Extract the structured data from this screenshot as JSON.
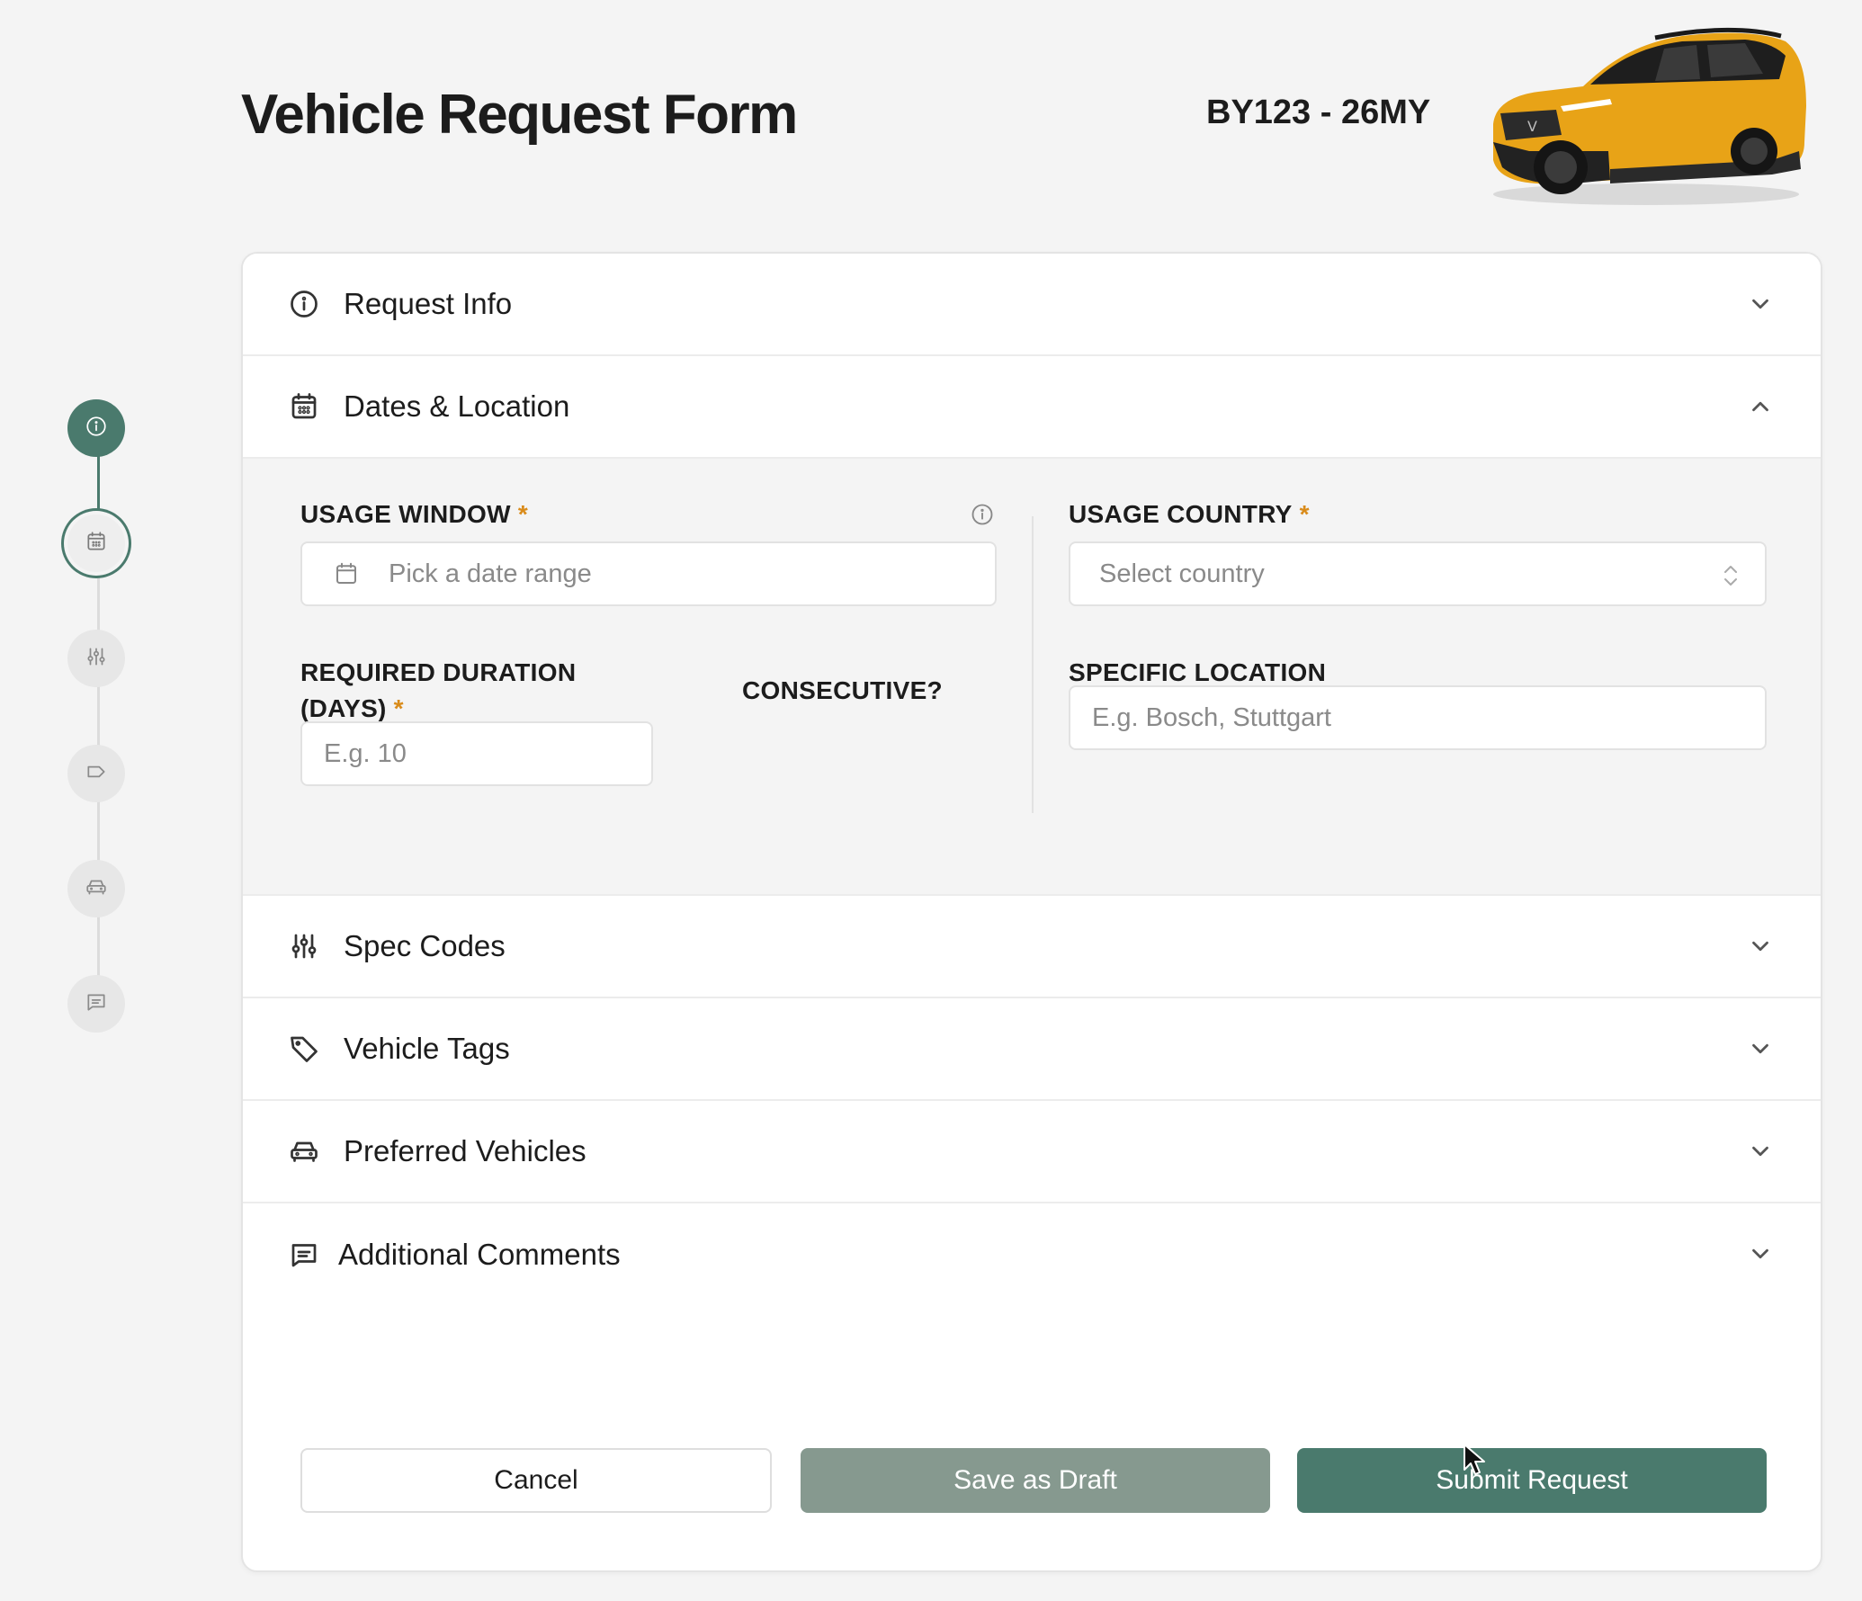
{
  "header": {
    "title": "Vehicle Request Form",
    "model_code": "BY123 - 26MY"
  },
  "stepper": {
    "steps": [
      {
        "icon": "info-icon",
        "state": "done"
      },
      {
        "icon": "calendar-icon",
        "state": "current"
      },
      {
        "icon": "sliders-icon",
        "state": "pending"
      },
      {
        "icon": "tag-icon",
        "state": "pending"
      },
      {
        "icon": "car-icon",
        "state": "pending"
      },
      {
        "icon": "comment-icon",
        "state": "pending"
      }
    ]
  },
  "sections": [
    {
      "title": "Request Info",
      "icon": "info-icon",
      "expanded": false
    },
    {
      "title": "Dates & Location",
      "icon": "calendar-icon",
      "expanded": true
    },
    {
      "title": "Spec Codes",
      "icon": "sliders-icon",
      "expanded": false
    },
    {
      "title": "Vehicle Tags",
      "icon": "tag-icon",
      "expanded": false
    },
    {
      "title": "Preferred Vehicles",
      "icon": "car-icon",
      "expanded": false
    },
    {
      "title": "Additional Comments",
      "icon": "comment-icon",
      "expanded": false
    }
  ],
  "dates_location": {
    "usage_window": {
      "label": "USAGE WINDOW",
      "required": "*",
      "placeholder": "Pick a date range"
    },
    "usage_country": {
      "label": "USAGE COUNTRY",
      "required": "*",
      "placeholder": "Select country"
    },
    "required_duration": {
      "label_line1": "REQUIRED DURATION",
      "label_line2": "(DAYS)",
      "required": "*",
      "placeholder": "E.g. 10"
    },
    "consecutive": {
      "label": "CONSECUTIVE?",
      "value": false
    },
    "specific_location": {
      "label": "SPECIFIC LOCATION",
      "placeholder": "E.g. Bosch, Stuttgart"
    }
  },
  "actions": {
    "cancel": "Cancel",
    "save_draft": "Save as Draft",
    "submit": "Submit Request"
  },
  "colors": {
    "accent": "#4a7a6d",
    "accent_muted": "#86998f",
    "required": "#d98b1a",
    "car_body": "#e8a317"
  }
}
